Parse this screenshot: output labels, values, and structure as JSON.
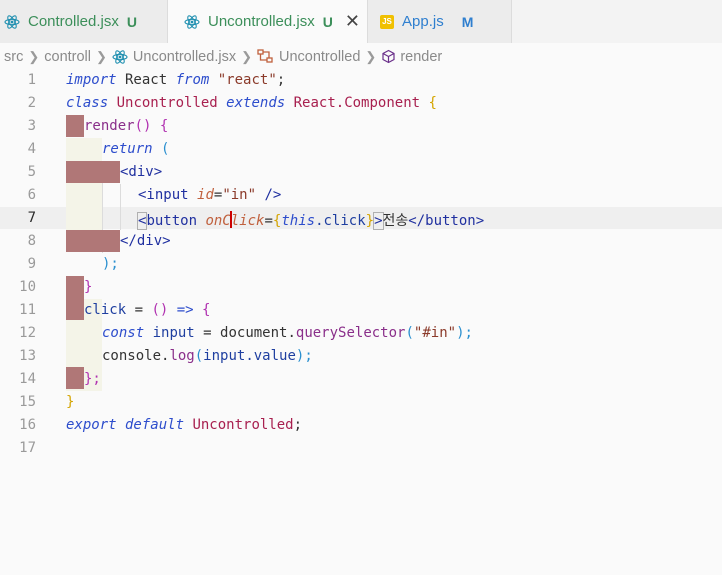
{
  "tabs": [
    {
      "name": "Controlled.jsx",
      "status": "U",
      "status_color": "#3c8f5a",
      "icon": "react-icon"
    },
    {
      "name": "Uncontrolled.jsx",
      "status": "U",
      "status_color": "#3c8f5a",
      "icon": "react-icon",
      "close": "✕"
    },
    {
      "name": "App.js",
      "status": "M",
      "status_color": "#2f7fcf",
      "icon": "js-icon",
      "icon_label": "JS"
    }
  ],
  "breadcrumbs": [
    "src",
    "controll",
    "Uncontrolled.jsx",
    "Uncontrolled",
    "render"
  ],
  "line_numbers": [
    "1",
    "2",
    "3",
    "4",
    "5",
    "6",
    "7",
    "8",
    "9",
    "10",
    "11",
    "12",
    "13",
    "14",
    "15",
    "16",
    "17"
  ],
  "current_line": "7",
  "code": {
    "l1_import": "import",
    "l1_react": " React ",
    "l1_from": "from",
    "l1_str": " \"react\"",
    "l1_semi": ";",
    "l2_class": "class",
    "l2_name": " Uncontrolled ",
    "l2_extends": "extends",
    "l2_comp": " React.Component ",
    "l2_brace": "{",
    "l3_render": "render",
    "l3_paren": "()",
    "l3_brace": " {",
    "l4_return": "return",
    "l4_paren": " (",
    "l5_tag": "<div>",
    "l6_open": "<input ",
    "l6_attr": "id",
    "l6_eq": "=",
    "l6_val": "\"in\"",
    "l6_close": " />",
    "l7_lt": "<",
    "l7_button": "button ",
    "l7_attr_a": "onC",
    "l7_attr_b": "lick",
    "l7_eq": "=",
    "l7_lb": "{",
    "l7_this": "this",
    "l7_click": ".click",
    "l7_rb": "}",
    "l7_gt": ">",
    "l7_text": "전송",
    "l7_end": "</button>",
    "l8_tag": "</div>",
    "l9_paren": ");",
    "l10_brace": "}",
    "l11_click": "click",
    "l11_eq": " = ",
    "l11_paren": "()",
    "l11_arrow": " => ",
    "l11_brace": "{",
    "l12_const": "const",
    "l12_input": " input",
    "l12_eq": " = ",
    "l12_doc": "document.",
    "l12_qs": "querySelector",
    "l12_lp": "(",
    "l12_str": "\"#in\"",
    "l12_rp": ");",
    "l13_console": "console.",
    "l13_log": "log",
    "l13_lp": "(",
    "l13_input": "input",
    "l13_value": ".value",
    "l13_rp": ");",
    "l14_end": "};",
    "l15_brace": "}",
    "l16_export": "export",
    "l16_default": " default",
    "l16_name": " Uncontrolled",
    "l16_semi": ";"
  }
}
